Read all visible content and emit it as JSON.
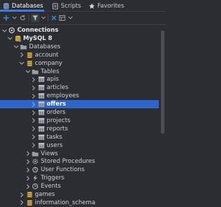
{
  "tabs": [
    {
      "label": "Databases",
      "icon": "database-icon",
      "active": true
    },
    {
      "label": "Scripts",
      "icon": "scripts-icon",
      "active": false
    },
    {
      "label": "Favorites",
      "icon": "star-icon",
      "active": false
    }
  ],
  "toolbar": {
    "icons": [
      "add-icon",
      "refresh-icon",
      "collapse-icon",
      "filter-icon",
      "chevron-down-icon",
      "schema-icon",
      "table-view-icon",
      "chevron-down-icon",
      "more-icon"
    ]
  },
  "tree": {
    "rows": [
      {
        "label": "Connections",
        "depth": 0,
        "state": "expanded",
        "icon": "connections-icon",
        "bold": true
      },
      {
        "label": "MySQL 8",
        "depth": 1,
        "state": "expanded",
        "icon": "mysql-icon",
        "bold": true
      },
      {
        "label": "Databases",
        "depth": 2,
        "state": "expanded",
        "icon": "folder-icon"
      },
      {
        "label": "account",
        "depth": 3,
        "state": "collapsed",
        "icon": "database-icon"
      },
      {
        "label": "company",
        "depth": 3,
        "state": "expanded",
        "icon": "database-icon"
      },
      {
        "label": "Tables",
        "depth": 4,
        "state": "expanded",
        "icon": "folder-icon"
      },
      {
        "label": "apis",
        "depth": 5,
        "state": "collapsed",
        "icon": "table-icon"
      },
      {
        "label": "articles",
        "depth": 5,
        "state": "collapsed",
        "icon": "table-icon"
      },
      {
        "label": "employees",
        "depth": 5,
        "state": "collapsed",
        "icon": "table-icon"
      },
      {
        "label": "offers",
        "depth": 5,
        "state": "collapsed",
        "icon": "table-icon",
        "selected": true
      },
      {
        "label": "orders",
        "depth": 5,
        "state": "collapsed",
        "icon": "table-icon"
      },
      {
        "label": "projects",
        "depth": 5,
        "state": "collapsed",
        "icon": "table-icon"
      },
      {
        "label": "reports",
        "depth": 5,
        "state": "collapsed",
        "icon": "table-icon"
      },
      {
        "label": "tasks",
        "depth": 5,
        "state": "collapsed",
        "icon": "table-icon"
      },
      {
        "label": "users",
        "depth": 5,
        "state": "collapsed",
        "icon": "table-icon"
      },
      {
        "label": "Views",
        "depth": 4,
        "state": "collapsed",
        "icon": "folder-icon"
      },
      {
        "label": "Stored Procedures",
        "depth": 4,
        "state": "collapsed",
        "icon": "gear-icon"
      },
      {
        "label": "User Functions",
        "depth": 4,
        "state": "collapsed",
        "icon": "function-icon"
      },
      {
        "label": "Triggers",
        "depth": 4,
        "state": "collapsed",
        "icon": "trigger-icon"
      },
      {
        "label": "Events",
        "depth": 4,
        "state": "collapsed",
        "icon": "clock-icon"
      },
      {
        "label": "games",
        "depth": 3,
        "state": "collapsed",
        "icon": "database-icon"
      },
      {
        "label": "information_schema",
        "depth": 3,
        "state": "collapsed",
        "icon": "database-icon"
      }
    ]
  },
  "colors": {
    "background": "#2b2d30",
    "selection": "#2f65ca",
    "accent": "#3d7ae8",
    "folder": "#c89d3f",
    "database": "#c8a24a"
  }
}
